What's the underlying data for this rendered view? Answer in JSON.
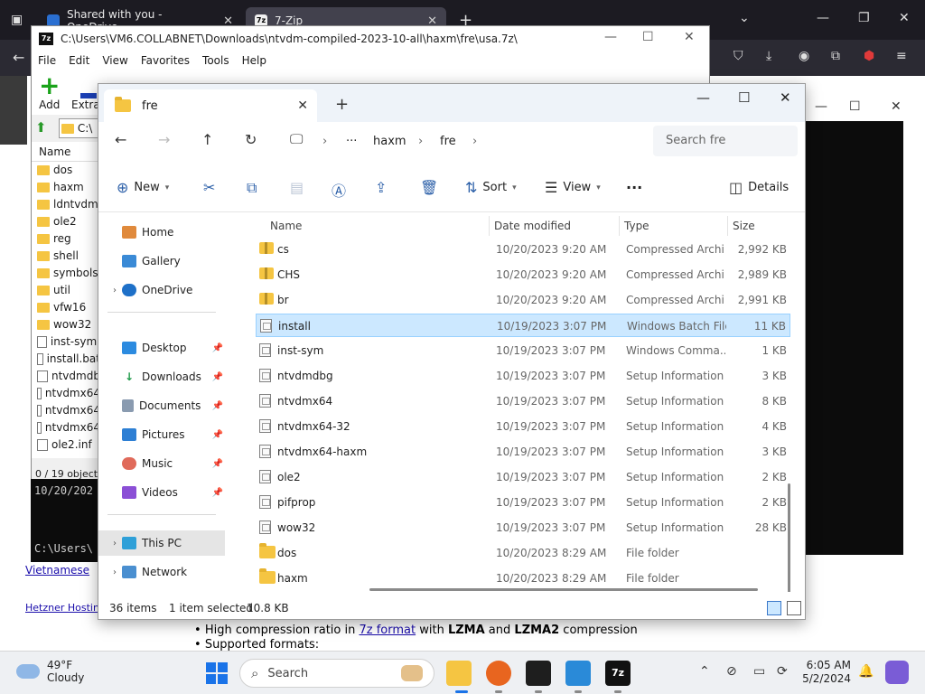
{
  "browser": {
    "tabs": [
      {
        "label": "Shared with you - OneDrive"
      },
      {
        "label": "7-Zip"
      }
    ],
    "page_text": {
      "bullet1_pre": "High compression ratio in ",
      "bullet1_link": "7z format",
      "bullet1_mid": " with ",
      "bullet1_b1": "LZMA",
      "bullet1_and": " and ",
      "bullet1_b2": "LZMA2",
      "bullet1_post": " compression",
      "bullet2": "Supported formats:",
      "hosting_link": "Hetzner Hostin",
      "lang_link": "Vietnamese"
    }
  },
  "sevenzip": {
    "title": "C:\\Users\\VM6.COLLABNET\\Downloads\\ntvdm-compiled-2023-10-all\\haxm\\fre\\usa.7z\\",
    "menu": [
      "File",
      "Edit",
      "View",
      "Favorites",
      "Tools",
      "Help"
    ],
    "tools": {
      "add": "Add",
      "extract": "Extrac"
    },
    "address": "C:\\",
    "column_name": "Name",
    "items": [
      {
        "name": "dos",
        "kind": "folder"
      },
      {
        "name": "haxm",
        "kind": "folder"
      },
      {
        "name": "ldntvdm",
        "kind": "folder"
      },
      {
        "name": "ole2",
        "kind": "folder"
      },
      {
        "name": "reg",
        "kind": "folder"
      },
      {
        "name": "shell",
        "kind": "folder"
      },
      {
        "name": "symbols",
        "kind": "folder"
      },
      {
        "name": "util",
        "kind": "folder"
      },
      {
        "name": "vfw16",
        "kind": "folder"
      },
      {
        "name": "wow32",
        "kind": "folder"
      },
      {
        "name": "inst-sym.",
        "kind": "file"
      },
      {
        "name": "install.bat",
        "kind": "file"
      },
      {
        "name": "ntvdmdb",
        "kind": "file"
      },
      {
        "name": "ntvdmx64",
        "kind": "file"
      },
      {
        "name": "ntvdmx64",
        "kind": "file"
      },
      {
        "name": "ntvdmx64",
        "kind": "file"
      },
      {
        "name": "ole2.inf",
        "kind": "file"
      }
    ],
    "status": "0 / 19 object(s",
    "cmd_line1": "10/20/202",
    "cmd_line2": "C:\\Users\\"
  },
  "explorer": {
    "tab_title": "fre",
    "breadcrumb": [
      "haxm",
      "fre"
    ],
    "search_placeholder": "Search fre",
    "commands": {
      "new": "New",
      "sort": "Sort",
      "view": "View",
      "details": "Details"
    },
    "sidebar": {
      "home": "Home",
      "gallery": "Gallery",
      "onedrive": "OneDrive",
      "desktop": "Desktop",
      "downloads": "Downloads",
      "documents": "Documents",
      "pictures": "Pictures",
      "music": "Music",
      "videos": "Videos",
      "thispc": "This PC",
      "network": "Network"
    },
    "columns": {
      "name": "Name",
      "date": "Date modified",
      "type": "Type",
      "size": "Size"
    },
    "files": [
      {
        "name": "cs",
        "date": "10/20/2023 9:20 AM",
        "type": "Compressed Archi...",
        "size": "2,992 KB",
        "icon": "zip"
      },
      {
        "name": "CHS",
        "date": "10/20/2023 9:20 AM",
        "type": "Compressed Archi...",
        "size": "2,989 KB",
        "icon": "zip"
      },
      {
        "name": "br",
        "date": "10/20/2023 9:20 AM",
        "type": "Compressed Archi...",
        "size": "2,991 KB",
        "icon": "zip"
      },
      {
        "name": "install",
        "date": "10/19/2023 3:07 PM",
        "type": "Windows Batch File",
        "size": "11 KB",
        "icon": "file",
        "selected": true
      },
      {
        "name": "inst-sym",
        "date": "10/19/2023 3:07 PM",
        "type": "Windows Comma...",
        "size": "1 KB",
        "icon": "file"
      },
      {
        "name": "ntvdmdbg",
        "date": "10/19/2023 3:07 PM",
        "type": "Setup Information",
        "size": "3 KB",
        "icon": "file"
      },
      {
        "name": "ntvdmx64",
        "date": "10/19/2023 3:07 PM",
        "type": "Setup Information",
        "size": "8 KB",
        "icon": "file"
      },
      {
        "name": "ntvdmx64-32",
        "date": "10/19/2023 3:07 PM",
        "type": "Setup Information",
        "size": "4 KB",
        "icon": "file"
      },
      {
        "name": "ntvdmx64-haxm",
        "date": "10/19/2023 3:07 PM",
        "type": "Setup Information",
        "size": "3 KB",
        "icon": "file"
      },
      {
        "name": "ole2",
        "date": "10/19/2023 3:07 PM",
        "type": "Setup Information",
        "size": "2 KB",
        "icon": "file"
      },
      {
        "name": "pifprop",
        "date": "10/19/2023 3:07 PM",
        "type": "Setup Information",
        "size": "2 KB",
        "icon": "file"
      },
      {
        "name": "wow32",
        "date": "10/19/2023 3:07 PM",
        "type": "Setup Information",
        "size": "28 KB",
        "icon": "file"
      },
      {
        "name": "dos",
        "date": "10/20/2023 8:29 AM",
        "type": "File folder",
        "size": "",
        "icon": "folder"
      },
      {
        "name": "haxm",
        "date": "10/20/2023 8:29 AM",
        "type": "File folder",
        "size": "",
        "icon": "folder"
      }
    ],
    "status": {
      "count": "36 items",
      "selected": "1 item selected",
      "size": "10.8 KB"
    }
  },
  "taskbar": {
    "temp": "49°F",
    "condition": "Cloudy",
    "search": "Search",
    "time": "6:05 AM",
    "date": "5/2/2024"
  }
}
